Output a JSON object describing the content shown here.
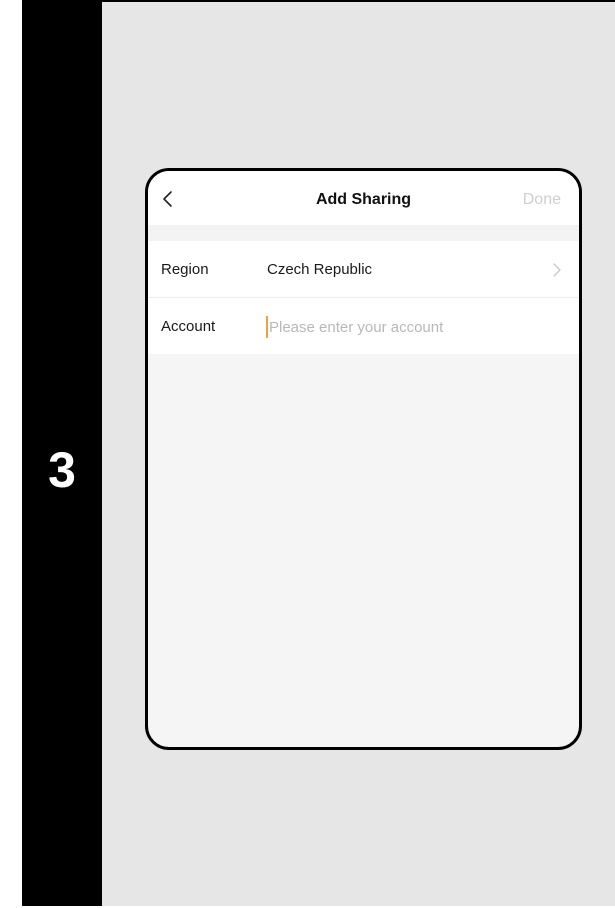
{
  "step": {
    "number": "3"
  },
  "screen": {
    "title": "Add Sharing",
    "done_label": "Done",
    "region": {
      "label": "Region",
      "value": "Czech Republic"
    },
    "account": {
      "label": "Account",
      "value": "",
      "placeholder": "Please enter your account"
    }
  },
  "colors": {
    "caret": "#f0a040",
    "done_disabled": "#cfcfcf",
    "panel_bg": "#e6e6e6"
  },
  "icons": {
    "back": "chevron-left-icon",
    "region_chevron": "chevron-right-icon"
  }
}
